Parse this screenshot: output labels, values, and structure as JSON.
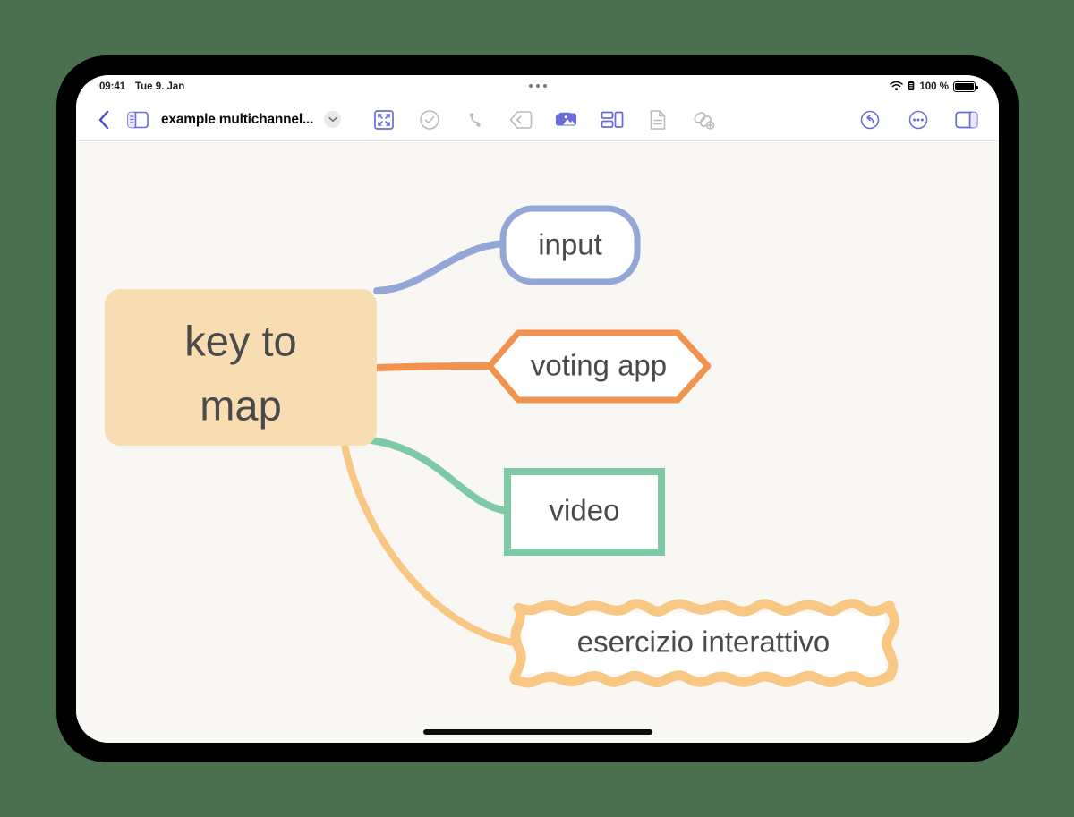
{
  "device": {
    "frame_color": "#000000",
    "page_background": "#4a7050",
    "screen_background": "#ffffff"
  },
  "status_bar": {
    "time": "09:41",
    "date": "Tue 9. Jan",
    "wifi_icon": "wifi-icon",
    "battery_percent": "100 %",
    "battery_icon": "battery-full-icon",
    "center_indicator": "three-dots-indicator"
  },
  "toolbar": {
    "back_label": "chevron-left-icon",
    "sidebar_toggle_label": "sidebar-panel-icon",
    "document_title": "example multichannel...",
    "title_menu_icon": "chevron-down-icon",
    "tools": [
      {
        "name": "fit-to-screen-icon",
        "state": "active"
      },
      {
        "name": "check-circle-icon",
        "state": "inactive"
      },
      {
        "name": "connection-line-icon",
        "state": "inactive"
      },
      {
        "name": "shape-marker-icon",
        "state": "inactive"
      },
      {
        "name": "photos-icon",
        "state": "active"
      },
      {
        "name": "layout-arrange-icon",
        "state": "active"
      },
      {
        "name": "document-icon",
        "state": "inactive"
      },
      {
        "name": "add-link-icon",
        "state": "inactive"
      }
    ],
    "right_tools": [
      {
        "name": "undo-icon",
        "state": "active"
      },
      {
        "name": "more-options-icon",
        "state": "active"
      },
      {
        "name": "sidebar-right-icon",
        "state": "active"
      }
    ]
  },
  "canvas": {
    "background": "#f8f7f4",
    "accent_purple": "#6a6cd8"
  },
  "mindmap": {
    "root": {
      "label_line1": "key to",
      "label_line2": "map",
      "shape": "rounded-rectangle",
      "fill": "#f8ddb3",
      "text_color": "#4a4a4a"
    },
    "branches": [
      {
        "label": "input",
        "shape": "rounded-pill",
        "stroke": "#92a7d6",
        "fill": "#ffffff",
        "connector_color": "#92a7d6"
      },
      {
        "label": "voting app",
        "shape": "hexagon",
        "stroke": "#f2924f",
        "fill": "#ffffff",
        "connector_color": "#f2924f"
      },
      {
        "label": "video",
        "shape": "rectangle",
        "stroke": "#7ecaa6",
        "fill": "#ffffff",
        "connector_color": "#7ecaa6"
      },
      {
        "label": "esercizio interattivo",
        "shape": "cloud-wavy",
        "stroke": "#f9c784",
        "fill": "#ffffff",
        "connector_color": "#f9c784"
      }
    ]
  },
  "home_indicator": "home-indicator-bar"
}
